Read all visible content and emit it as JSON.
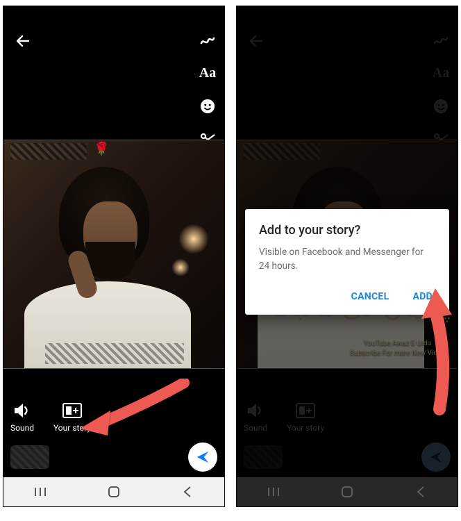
{
  "tools": {
    "text_label": "Aa"
  },
  "bottom": {
    "sound_label": "Sound",
    "story_label": "Your story"
  },
  "dialog": {
    "title": "Add to your story?",
    "body": "Visible on Facebook and Messenger for 24 hours.",
    "cancel": "CANCEL",
    "add": "ADD"
  },
  "overlay": {
    "line1": "YouTube Awaz E Urdu",
    "line2": "Subscribe For more New Video"
  }
}
